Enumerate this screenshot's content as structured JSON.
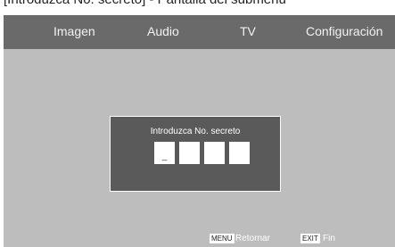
{
  "caption": "[Introduzca No. secreto] - Pantalla del submenú",
  "menu": {
    "tabs": [
      "Imagen",
      "Audio",
      "TV",
      "Configuración"
    ]
  },
  "dialog": {
    "title": "Introduzca No. secreto",
    "pin": [
      "_",
      "",
      "",
      ""
    ]
  },
  "footer": {
    "menu_key": "MENU",
    "menu_label": "Retornar",
    "exit_key": "EXIT",
    "exit_label": "Fin"
  }
}
